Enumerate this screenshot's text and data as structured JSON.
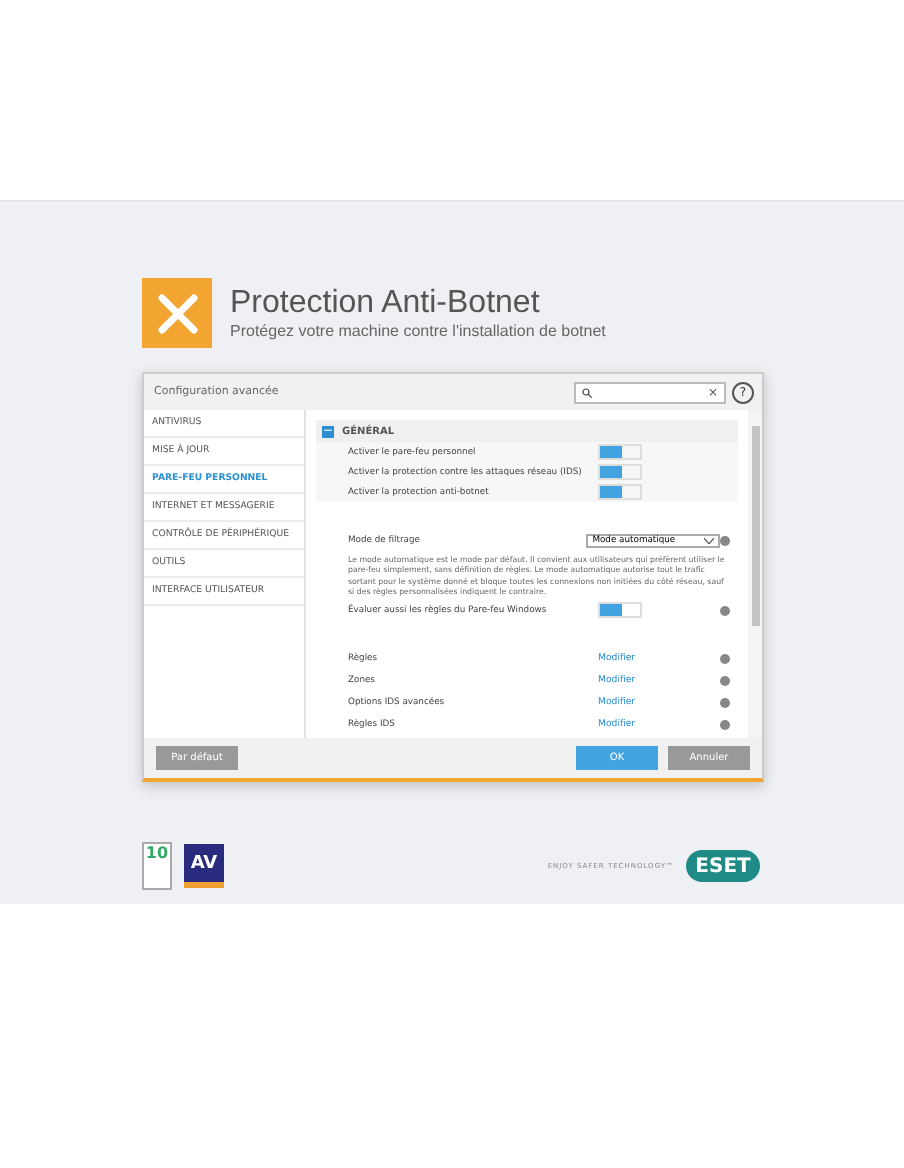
{
  "header": {
    "title": "Protection Anti-Botnet",
    "subtitle": "Protégez votre machine contre l'installation de botnet"
  },
  "dialog": {
    "title": "Configuration avancée",
    "clear": "×",
    "help": "?",
    "sidebar": [
      {
        "label": "ANTIVIRUS",
        "selected": false
      },
      {
        "label": "MISE À JOUR",
        "selected": false
      },
      {
        "label": "PARE-FEU PERSONNEL",
        "selected": true
      },
      {
        "label": "INTERNET ET MESSAGERIE",
        "selected": false
      },
      {
        "label": "CONTRÔLE DE PÉRIPHÉRIQUE",
        "selected": false
      },
      {
        "label": "OUTILS",
        "selected": false
      },
      {
        "label": "INTERFACE UTILISATEUR",
        "selected": false
      }
    ],
    "section": {
      "title": "GÉNÉRAL",
      "expanded": true,
      "collapse": "−"
    },
    "rows": [
      {
        "kind": "toggle",
        "label": "Activer le pare-feu personnel",
        "on": true
      },
      {
        "kind": "toggle",
        "label": "Activer la protection contre les attaques réseau (IDS)",
        "on": true
      },
      {
        "kind": "toggle",
        "label": "Activer la protection anti-botnet",
        "on": true
      },
      {
        "kind": "spacer"
      },
      {
        "kind": "select",
        "label": "Mode de filtrage",
        "value": "Mode automatique"
      },
      {
        "kind": "note",
        "text": "Le mode automatique est le mode par défaut. Il convient aux utilisateurs qui préfèrent utiliser le pare-feu simplement, sans définition de règles. Le mode automatique autorise tout le trafic sortant pour le système donné et bloque toutes les connexions non initiées du côté réseau, sauf si des règles personnalisées indiquent le contraire."
      },
      {
        "kind": "toggle",
        "label": "Évaluer aussi les règles du Pare-feu Windows",
        "on": true,
        "info": true
      },
      {
        "kind": "spacer"
      },
      {
        "kind": "link",
        "label": "Règles",
        "link": "Modifier"
      },
      {
        "kind": "link",
        "label": "Zones",
        "link": "Modifier"
      },
      {
        "kind": "link",
        "label": "Options IDS avancées",
        "link": "Modifier"
      },
      {
        "kind": "link",
        "label": "Règles IDS",
        "link": "Modifier"
      }
    ],
    "buttons": [
      {
        "label": "Par défaut",
        "kind": "secondary"
      },
      {
        "label": "OK",
        "kind": "primary"
      },
      {
        "label": "Annuler",
        "kind": "secondary"
      }
    ]
  },
  "footer": {
    "badges": [
      {
        "kind": "years",
        "label": "10"
      },
      {
        "kind": "av",
        "label": "AV"
      }
    ],
    "tagline": "ENJOY SAFER TECHNOLOGY™",
    "logo": "ESET"
  }
}
